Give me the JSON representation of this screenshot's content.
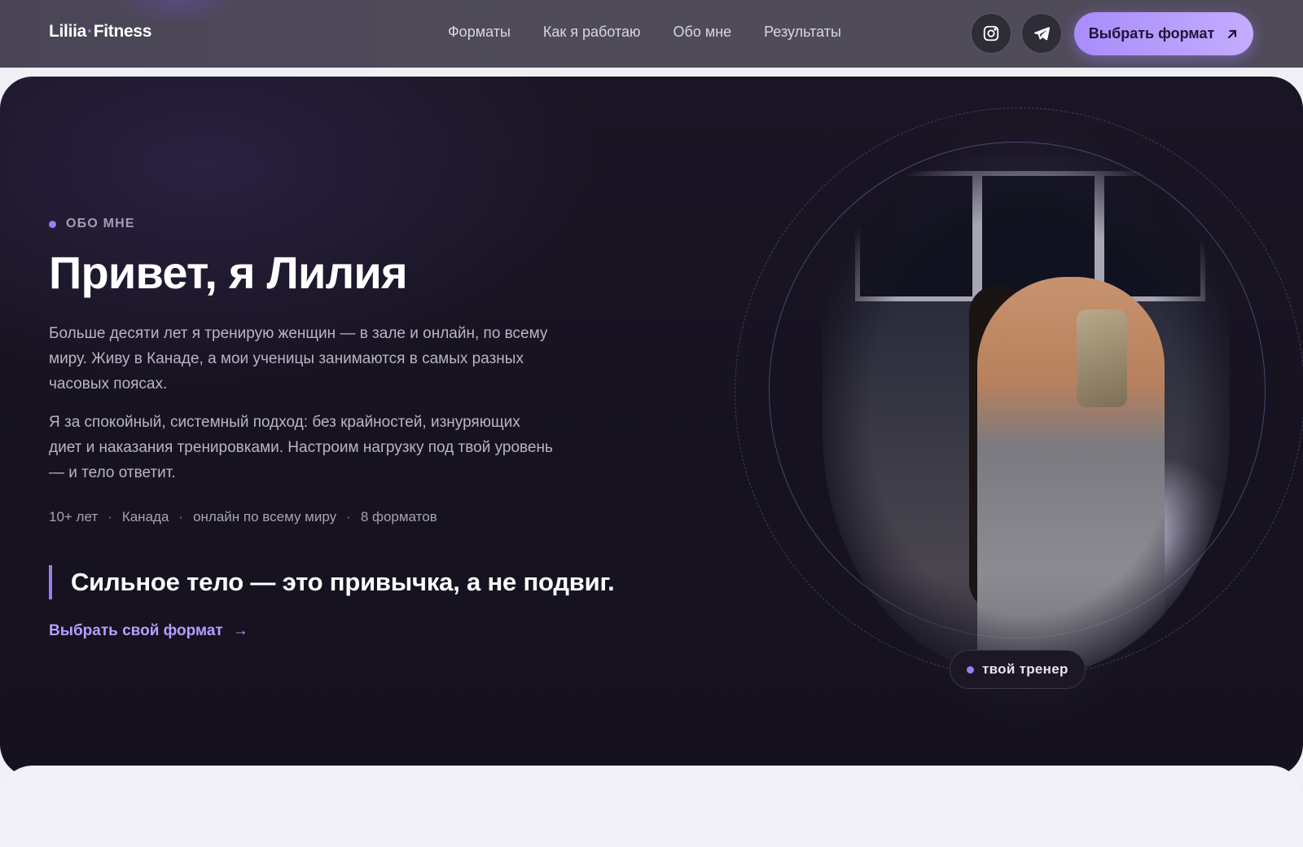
{
  "header": {
    "logo_left": "Liliia",
    "logo_dot": "·",
    "logo_right": "Fitness",
    "nav": [
      "Форматы",
      "Как я работаю",
      "Обо мне",
      "Результаты"
    ],
    "cta_label": "Выбрать формат",
    "icons": [
      "instagram-icon",
      "telegram-icon",
      "arrow-up-right-icon"
    ]
  },
  "hero": {
    "eyebrow": "ОБО МНЕ",
    "title": "Привет, я Лилия",
    "paragraph1": "Больше десяти лет я тренирую женщин — в зале и онлайн, по всему миру. Живу в Канаде, а мои ученицы занимаются в самых разных часовых поясах.",
    "paragraph2": "Я за спокойный, системный подход: без крайностей, изнуряющих диет и наказания тренировками. Настроим нагрузку под твой уровень — и тело ответит.",
    "facts": [
      "10+ лет",
      "Канада",
      "онлайн по всему миру",
      "8 форматов"
    ],
    "fact_separator": "·",
    "quote": "Сильное тело — это привычка, а не подвиг.",
    "link_label": "Выбрать свой формат",
    "link_arrow": "→",
    "badge": "твой тренер"
  },
  "colors": {
    "accent": "#9b7df0",
    "cta_gradient_start": "#a98cfb",
    "cta_gradient_end": "#c4acff",
    "hero_bg": "#161220",
    "header_bg": "#4f4b59"
  }
}
